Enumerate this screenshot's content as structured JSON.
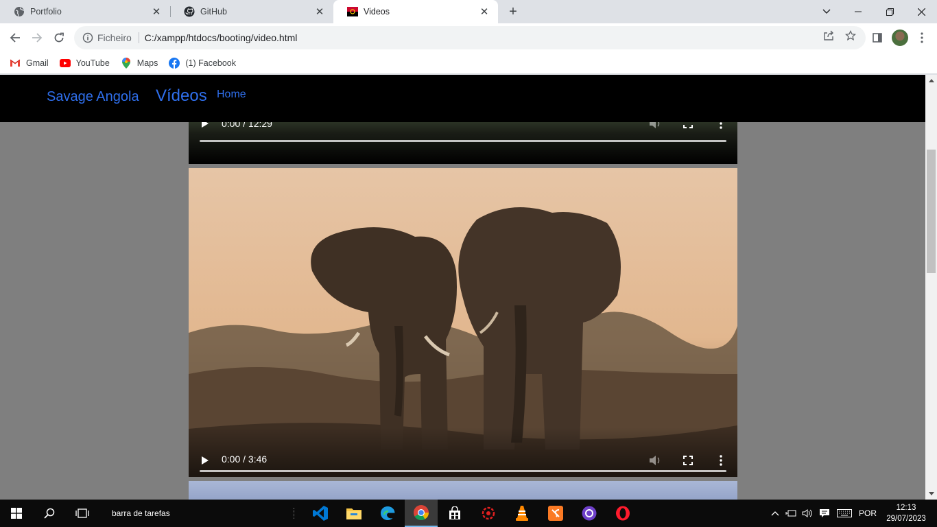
{
  "browser": {
    "tabs": [
      {
        "label": "Portfolio",
        "icon": "globe-icon"
      },
      {
        "label": "GitHub",
        "icon": "github-icon"
      },
      {
        "label": "Videos",
        "icon": "angola-flag-icon",
        "active": true
      }
    ],
    "address": {
      "protocol_label": "Ficheiro",
      "url": "C:/xampp/htdocs/booting/video.html"
    },
    "bookmarks": [
      {
        "label": "Gmail",
        "icon": "gmail-icon"
      },
      {
        "label": "YouTube",
        "icon": "youtube-icon"
      },
      {
        "label": "Maps",
        "icon": "maps-icon"
      },
      {
        "label": "(1) Facebook",
        "icon": "facebook-icon"
      }
    ]
  },
  "page": {
    "brand": "Savage Angola",
    "heading": "Vídeos",
    "nav_link": "Home",
    "videos": [
      {
        "time": "0:00 / 12:29"
      },
      {
        "time": "0:00 / 3:46"
      }
    ]
  },
  "taskbar": {
    "search_label": "barra de tarefas",
    "language": "POR",
    "time": "12:13",
    "date": "29/07/2023"
  },
  "colors": {
    "link_blue": "#2f6fec",
    "navbar_bg": "#000000",
    "page_bg": "#7f7f7f",
    "taskbar_bg": "#0b0b0b"
  }
}
